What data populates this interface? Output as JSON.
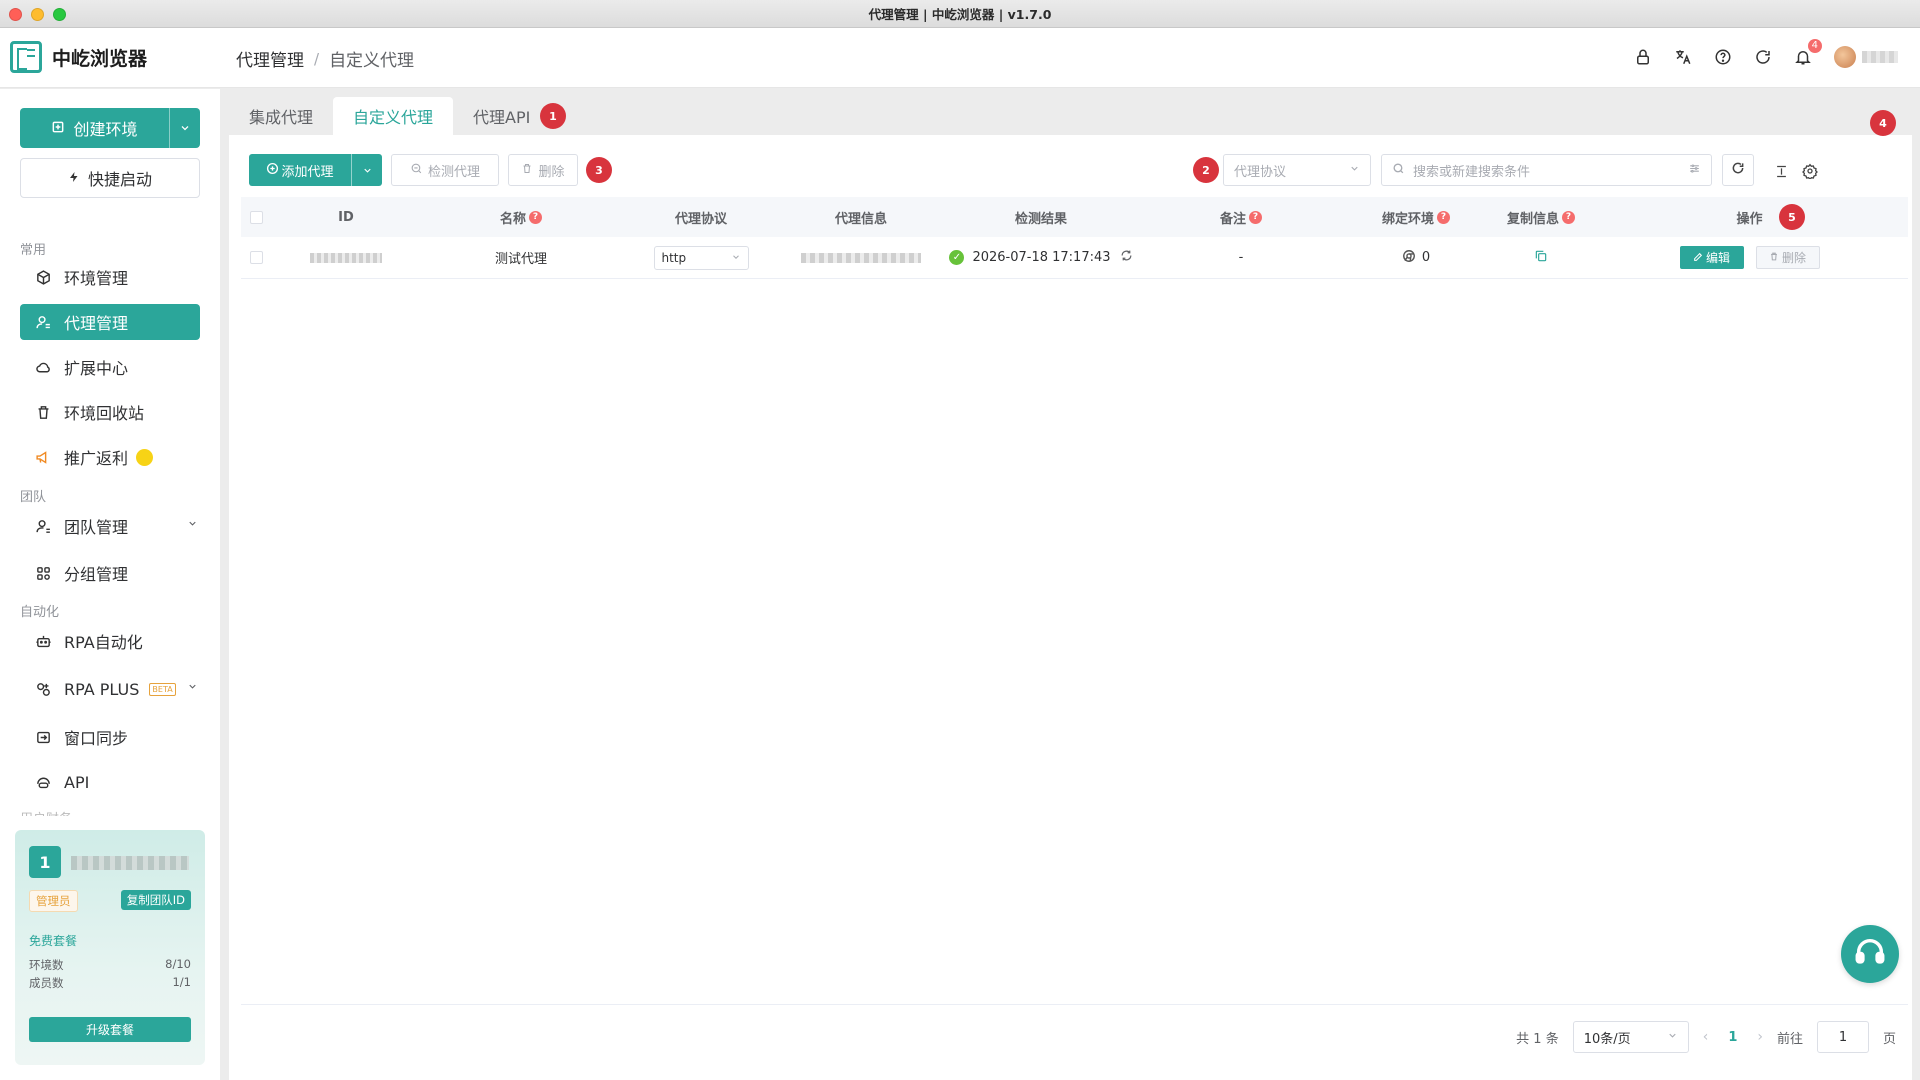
{
  "window": {
    "title": "代理管理 | 中屹浏览器 | v1.7.0"
  },
  "brand": {
    "name": "中屹浏览器",
    "color": "#2ba69a"
  },
  "breadcrumb": {
    "parent": "代理管理",
    "separator": "/",
    "current": "自定义代理"
  },
  "header": {
    "icons": [
      "lock-icon",
      "translate-icon",
      "help-icon",
      "refresh-icon",
      "bell-icon"
    ],
    "notification_count": "4"
  },
  "sidebar": {
    "create_label": "创建环境",
    "quick_label": "快捷启动",
    "groups": {
      "common": "常用",
      "team": "团队",
      "automation": "自动化"
    },
    "items": {
      "env": "环境管理",
      "proxy": "代理管理",
      "ext": "扩展中心",
      "recycle": "环境回收站",
      "promo": "推广返利",
      "team": "团队管理",
      "group": "分组管理",
      "rpa": "RPA自动化",
      "rpaplus": "RPA PLUS",
      "rpaplus_badge": "BETA",
      "sync": "窗口同步",
      "api": "API"
    }
  },
  "team_card": {
    "number": "1",
    "role": "管理员",
    "copy_id": "复制团队ID",
    "plan": "免费套餐",
    "env_label": "环境数",
    "env_value": "8/10",
    "member_label": "成员数",
    "member_value": "1/1",
    "upgrade": "升级套餐"
  },
  "tabs": [
    {
      "label": "集成代理"
    },
    {
      "label": "自定义代理"
    },
    {
      "label": "代理API"
    }
  ],
  "markers": [
    "1",
    "2",
    "3",
    "4",
    "5"
  ],
  "toolbar": {
    "add": "添加代理",
    "check": "检测代理",
    "delete": "删除",
    "protocol_placeholder": "代理协议",
    "search_placeholder": "搜索或新建搜索条件"
  },
  "table": {
    "columns": [
      "ID",
      "名称",
      "代理协议",
      "代理信息",
      "检测结果",
      "备注",
      "绑定环境",
      "复制信息",
      "操作"
    ],
    "rows": [
      {
        "name": "测试代理",
        "protocol": "http",
        "check_result": "2026-07-18 17:17:43",
        "remark": "-",
        "bound_envs": "0",
        "edit": "编辑",
        "delete": "删除"
      }
    ]
  },
  "pagination": {
    "total": "共 1 条",
    "page_size": "10条/页",
    "current": "1",
    "goto_label": "前往",
    "goto_value": "1",
    "page_unit": "页"
  }
}
